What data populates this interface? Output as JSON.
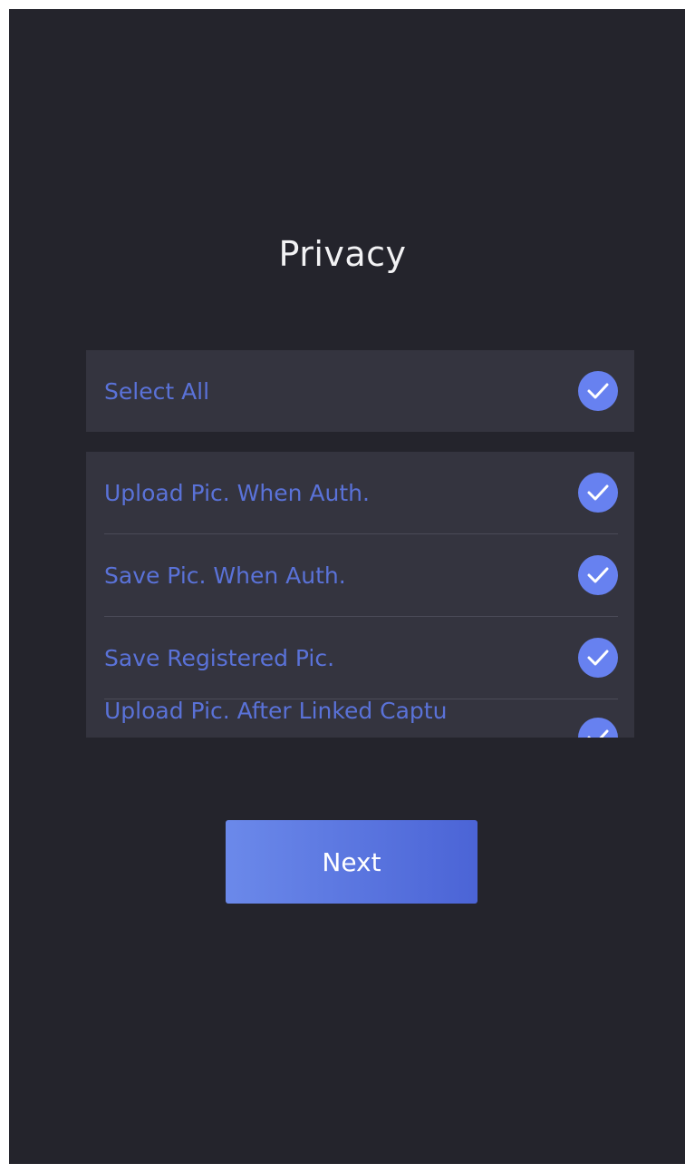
{
  "page": {
    "title": "Privacy"
  },
  "select_all": {
    "label": "Select All",
    "checked": true
  },
  "options": [
    {
      "label": "Upload Pic. When Auth.",
      "checked": true
    },
    {
      "label": "Save Pic. When Auth.",
      "checked": true
    },
    {
      "label": "Save Registered Pic.",
      "checked": true
    },
    {
      "label": "Upload Pic. After Linked Captu",
      "checked": true
    }
  ],
  "actions": {
    "next_label": "Next"
  },
  "colors": {
    "background": "#24242c",
    "panel": "#34343f",
    "accent": "#6781f0",
    "label_text": "#5a72d8",
    "title_text": "#f2f2f4"
  }
}
